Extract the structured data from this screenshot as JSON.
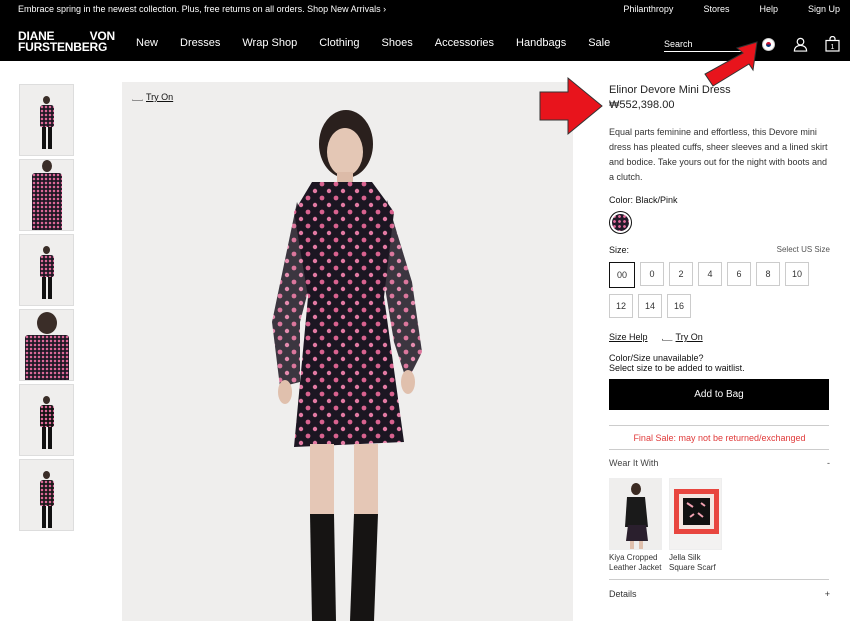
{
  "promo": {
    "message": "Embrace spring in the newest collection. Plus, free returns on all orders. Shop New Arrivals ›",
    "links": [
      "Philanthropy",
      "Stores",
      "Help",
      "Sign Up"
    ]
  },
  "nav": {
    "logo_line1_left": "DIANE",
    "logo_line1_right": "VON",
    "logo_line2": "FURSTENBERG",
    "menu": [
      "New",
      "Dresses",
      "Wrap Shop",
      "Clothing",
      "Shoes",
      "Accessories",
      "Handbags",
      "Sale"
    ],
    "search_placeholder": "Search",
    "bag_count": "1",
    "icons": [
      "korea-flag-icon",
      "user-icon",
      "shopping-bag-icon"
    ]
  },
  "gallery": {
    "try_on": "Try On"
  },
  "product": {
    "title": "Elinor Devore Mini Dress",
    "price": "₩552,398.00",
    "description": "Equal parts feminine and effortless, this Devore mini dress has pleated cuffs, sheer sleeves and a lined skirt and bodice. Take yours out for the night with boots and a clutch.",
    "color_label": "Color: Black/Pink",
    "size_label": "Size:",
    "size_select": "Select US Size",
    "sizes": [
      "00",
      "0",
      "2",
      "4",
      "6",
      "8",
      "10",
      "12",
      "14",
      "16"
    ],
    "size_help": "Size Help",
    "try_on": "Try On",
    "unavailable_title": "Color/Size unavailable?",
    "unavailable_text": "Select size to be added to waitlist.",
    "add_to_bag": "Add to Bag",
    "final_sale": "Final Sale: may not be returned/exchanged",
    "wear_it_with": "Wear It With",
    "wear_toggle": "-",
    "wear_items": [
      {
        "name": "Kiya Cropped Leather Jacket"
      },
      {
        "name": "Jella Silk Square Scarf"
      }
    ],
    "details": "Details",
    "details_toggle": "+"
  },
  "colors": {
    "accent_red": "#e8141c",
    "final_sale_red": "#e03a3a",
    "black": "#000000"
  }
}
